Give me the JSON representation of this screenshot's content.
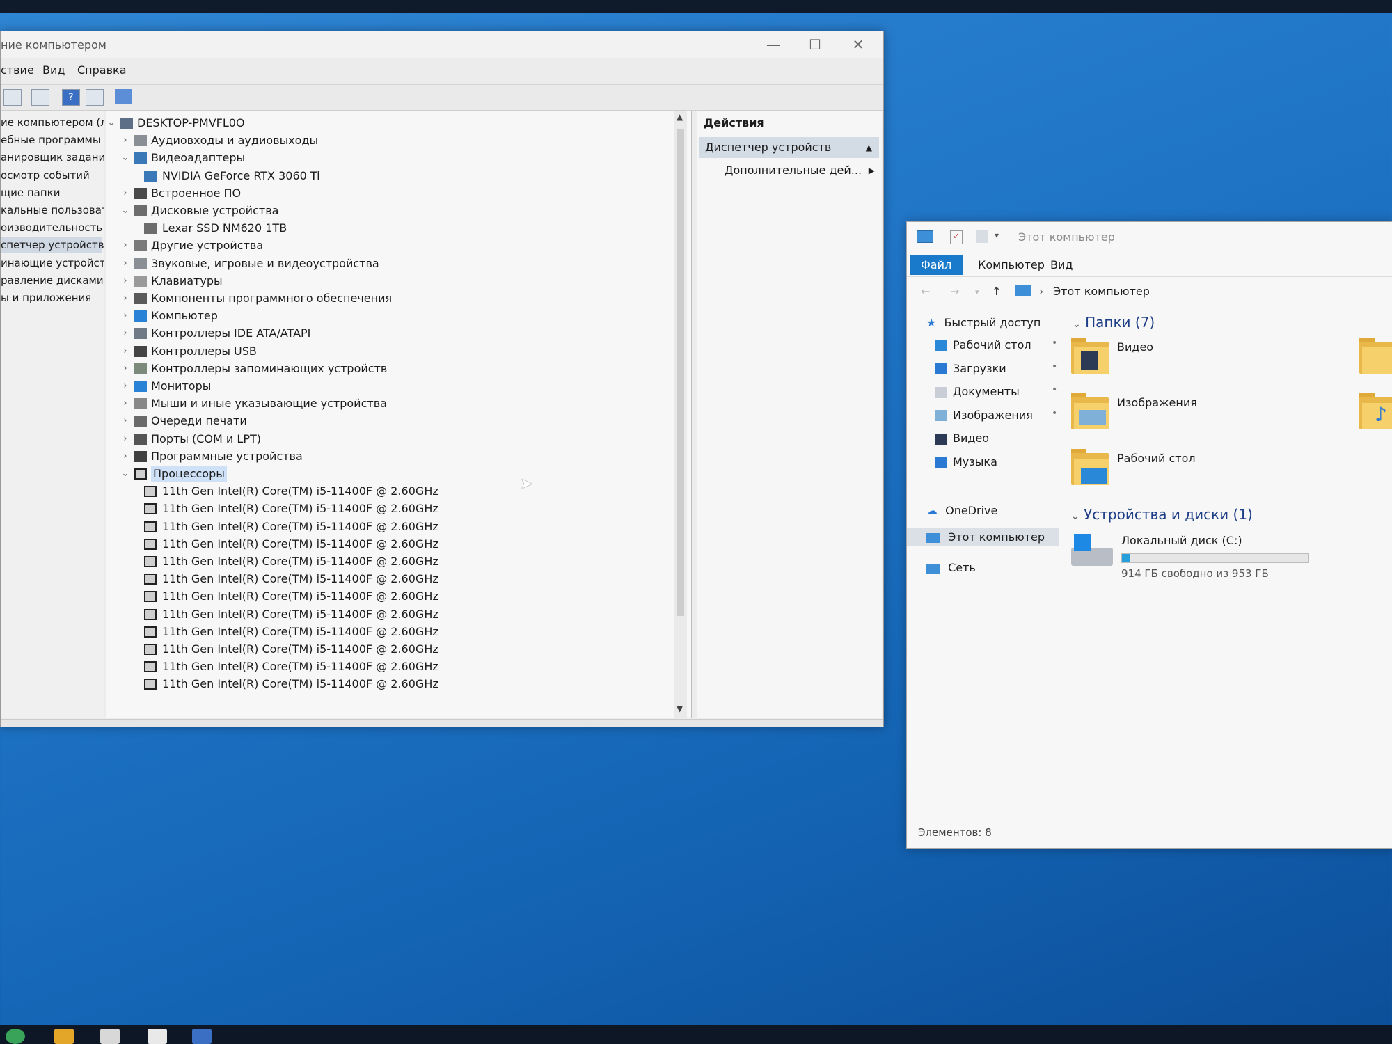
{
  "computer_management": {
    "title": "ние компьютером",
    "menu": [
      "ствие",
      "Вид",
      "Справка"
    ],
    "left_nav": [
      {
        "label": "ие компьютером (л",
        "selected": false
      },
      {
        "label": "ебные программы",
        "selected": false
      },
      {
        "label": "анировщик заданий",
        "selected": false
      },
      {
        "label": "осмотр событий",
        "selected": false
      },
      {
        "label": "щие папки",
        "selected": false
      },
      {
        "label": "кальные пользовате",
        "selected": false
      },
      {
        "label": "оизводительность",
        "selected": false
      },
      {
        "label": "спетчер устройств",
        "selected": true
      },
      {
        "label": "инающие устройст",
        "selected": false
      },
      {
        "label": "равление дисками",
        "selected": false
      },
      {
        "label": "ы и приложения",
        "selected": false
      }
    ],
    "tree": [
      {
        "label": "DESKTOP-PMVFL0O",
        "level": 0,
        "expanded": true,
        "icon": "computer-icon"
      },
      {
        "label": "Аудиовходы и аудиовыходы",
        "level": 1,
        "expanded": false,
        "icon": "speaker-icon"
      },
      {
        "label": "Видеоадаптеры",
        "level": 1,
        "expanded": true,
        "icon": "display-adapter-icon"
      },
      {
        "label": "NVIDIA GeForce RTX 3060 Ti",
        "level": 2,
        "icon": "display-adapter-icon"
      },
      {
        "label": "Встроенное ПО",
        "level": 1,
        "expanded": false,
        "icon": "firmware-icon"
      },
      {
        "label": "Дисковые устройства",
        "level": 1,
        "expanded": true,
        "icon": "disk-icon"
      },
      {
        "label": "Lexar SSD NM620 1TB",
        "level": 2,
        "icon": "disk-icon"
      },
      {
        "label": "Другие устройства",
        "level": 1,
        "expanded": false,
        "icon": "unknown-device-icon"
      },
      {
        "label": "Звуковые, игровые и видеоустройства",
        "level": 1,
        "expanded": false,
        "icon": "speaker-icon"
      },
      {
        "label": "Клавиатуры",
        "level": 1,
        "expanded": false,
        "icon": "keyboard-icon"
      },
      {
        "label": "Компоненты программного обеспечения",
        "level": 1,
        "expanded": false,
        "icon": "software-component-icon"
      },
      {
        "label": "Компьютер",
        "level": 1,
        "expanded": false,
        "icon": "monitor-icon"
      },
      {
        "label": "Контроллеры IDE ATA/ATAPI",
        "level": 1,
        "expanded": false,
        "icon": "ide-controller-icon"
      },
      {
        "label": "Контроллеры USB",
        "level": 1,
        "expanded": false,
        "icon": "usb-icon"
      },
      {
        "label": "Контроллеры запоминающих устройств",
        "level": 1,
        "expanded": false,
        "icon": "storage-controller-icon"
      },
      {
        "label": "Мониторы",
        "level": 1,
        "expanded": false,
        "icon": "monitor-icon"
      },
      {
        "label": "Мыши и иные указывающие устройства",
        "level": 1,
        "expanded": false,
        "icon": "mouse-icon"
      },
      {
        "label": "Очереди печати",
        "level": 1,
        "expanded": false,
        "icon": "printer-icon"
      },
      {
        "label": "Порты (COM и LPT)",
        "level": 1,
        "expanded": false,
        "icon": "port-icon"
      },
      {
        "label": "Программные устройства",
        "level": 1,
        "expanded": false,
        "icon": "software-device-icon"
      },
      {
        "label": "Процессоры",
        "level": 1,
        "expanded": true,
        "icon": "cpu-icon",
        "selected": true
      },
      {
        "label": "11th Gen Intel(R) Core(TM) i5-11400F @ 2.60GHz",
        "level": 2,
        "icon": "cpu-icon"
      },
      {
        "label": "11th Gen Intel(R) Core(TM) i5-11400F @ 2.60GHz",
        "level": 2,
        "icon": "cpu-icon"
      },
      {
        "label": "11th Gen Intel(R) Core(TM) i5-11400F @ 2.60GHz",
        "level": 2,
        "icon": "cpu-icon"
      },
      {
        "label": "11th Gen Intel(R) Core(TM) i5-11400F @ 2.60GHz",
        "level": 2,
        "icon": "cpu-icon"
      },
      {
        "label": "11th Gen Intel(R) Core(TM) i5-11400F @ 2.60GHz",
        "level": 2,
        "icon": "cpu-icon"
      },
      {
        "label": "11th Gen Intel(R) Core(TM) i5-11400F @ 2.60GHz",
        "level": 2,
        "icon": "cpu-icon"
      },
      {
        "label": "11th Gen Intel(R) Core(TM) i5-11400F @ 2.60GHz",
        "level": 2,
        "icon": "cpu-icon"
      },
      {
        "label": "11th Gen Intel(R) Core(TM) i5-11400F @ 2.60GHz",
        "level": 2,
        "icon": "cpu-icon"
      },
      {
        "label": "11th Gen Intel(R) Core(TM) i5-11400F @ 2.60GHz",
        "level": 2,
        "icon": "cpu-icon"
      },
      {
        "label": "11th Gen Intel(R) Core(TM) i5-11400F @ 2.60GHz",
        "level": 2,
        "icon": "cpu-icon"
      },
      {
        "label": "11th Gen Intel(R) Core(TM) i5-11400F @ 2.60GHz",
        "level": 2,
        "icon": "cpu-icon"
      },
      {
        "label": "11th Gen Intel(R) Core(TM) i5-11400F @ 2.60GHz",
        "level": 2,
        "icon": "cpu-icon"
      }
    ],
    "actions": {
      "header": "Действия",
      "selected": "Диспетчер устройств",
      "more": "Дополнительные дей..."
    }
  },
  "explorer": {
    "title": "Этот компьютер",
    "ribbon_tabs": [
      "Файл",
      "Компьютер",
      "Вид"
    ],
    "address": "Этот компьютер",
    "nav": {
      "quick_access": "Быстрый доступ",
      "quick_items": [
        {
          "label": "Рабочий стол",
          "icon": "desktop-icon",
          "pinned": true
        },
        {
          "label": "Загрузки",
          "icon": "download-icon",
          "pinned": true
        },
        {
          "label": "Документы",
          "icon": "document-icon",
          "pinned": true
        },
        {
          "label": "Изображения",
          "icon": "pictures-icon",
          "pinned": true
        },
        {
          "label": "Видео",
          "icon": "video-icon",
          "pinned": false
        },
        {
          "label": "Музыка",
          "icon": "music-icon",
          "pinned": false
        }
      ],
      "onedrive": "OneDrive",
      "this_pc": "Этот компьютер",
      "network": "Сеть"
    },
    "groups": {
      "folders": "Папки (7)",
      "devices": "Устройства и диски (1)"
    },
    "folders": [
      "Видео",
      "Изображения",
      "Рабочий стол"
    ],
    "drive": {
      "name": "Локальный диск (C:)",
      "free_text": "914 ГБ свободно из 953 ГБ",
      "used_fraction": 0.04
    },
    "status": "Элементов: 8"
  },
  "colors": {
    "accent": "#1979ca",
    "desktop": "#1f74c6",
    "folder": "#f6d06a"
  }
}
